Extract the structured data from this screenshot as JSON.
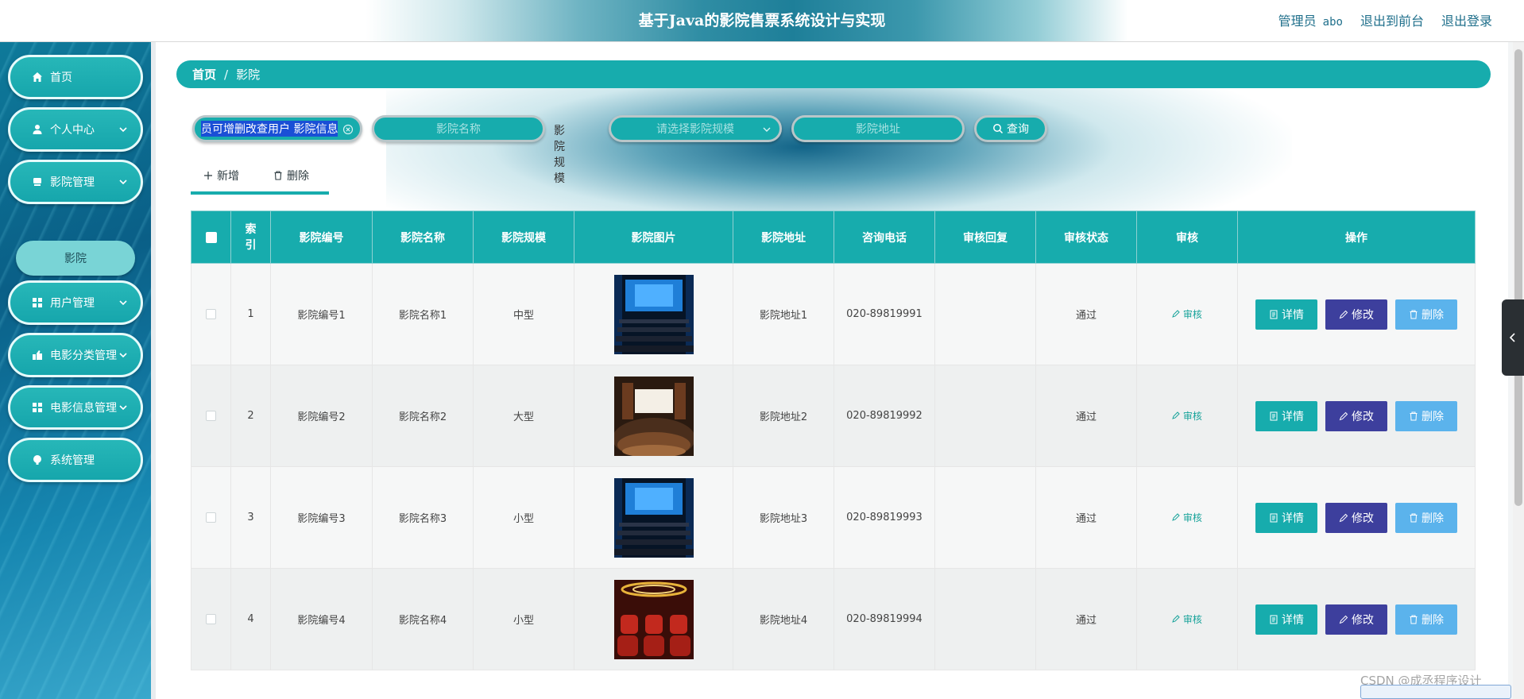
{
  "header": {
    "title": "基于Java的影院售票系统设计与实现",
    "role": "管理员",
    "username": "abo",
    "to_front": "退出到前台",
    "logout": "退出登录"
  },
  "sidebar": {
    "items": [
      {
        "label": "首页",
        "icon": "home-icon"
      },
      {
        "label": "个人中心",
        "icon": "user-icon"
      },
      {
        "label": "影院管理",
        "icon": "cinema-icon"
      },
      {
        "label": "用户管理",
        "icon": "grid-icon"
      },
      {
        "label": "电影分类管理",
        "icon": "category-icon"
      },
      {
        "label": "电影信息管理",
        "icon": "grid-icon"
      },
      {
        "label": "系统管理",
        "icon": "settings-icon"
      }
    ],
    "active_sub": "影院"
  },
  "breadcrumb": {
    "home": "首页",
    "separator": "/",
    "current": "影院"
  },
  "search": {
    "first_field_value": "员可增删改查用户 影院信息",
    "name_placeholder": "影院名称",
    "scale_label": "影院规模",
    "scale_placeholder": "请选择影院规模",
    "address_placeholder": "影院地址",
    "query_label": "查询"
  },
  "actions": {
    "add": "新增",
    "delete": "删除"
  },
  "table": {
    "headers": [
      "索引",
      "影院编号",
      "影院名称",
      "影院规模",
      "影院图片",
      "影院地址",
      "咨询电话",
      "审核回复",
      "审核状态",
      "审核",
      "操作"
    ],
    "audit_link": "审核",
    "op_detail": "详情",
    "op_edit": "修改",
    "op_delete": "删除",
    "rows": [
      {
        "index": "1",
        "code": "影院编号1",
        "name": "影院名称1",
        "scale": "中型",
        "image": "blue-screen-theater",
        "address": "影院地址1",
        "phone": "020-89819991",
        "reply": "",
        "status": "通过"
      },
      {
        "index": "2",
        "code": "影院编号2",
        "name": "影院名称2",
        "scale": "大型",
        "image": "crowded-theater",
        "address": "影院地址2",
        "phone": "020-89819992",
        "reply": "",
        "status": "通过"
      },
      {
        "index": "3",
        "code": "影院编号3",
        "name": "影院名称3",
        "scale": "小型",
        "image": "blue-screen-theater",
        "address": "影院地址3",
        "phone": "020-89819993",
        "reply": "",
        "status": "通过"
      },
      {
        "index": "4",
        "code": "影院编号4",
        "name": "影院名称4",
        "scale": "小型",
        "image": "red-seats-theater",
        "address": "影院地址4",
        "phone": "020-89819994",
        "reply": "",
        "status": "通过"
      }
    ]
  },
  "watermark": "CSDN @成丞程序设计",
  "colors": {
    "accent": "#17acad",
    "edit": "#3d3f9d",
    "delete": "#5bb3ec",
    "sidebar": "#0a5f87"
  }
}
